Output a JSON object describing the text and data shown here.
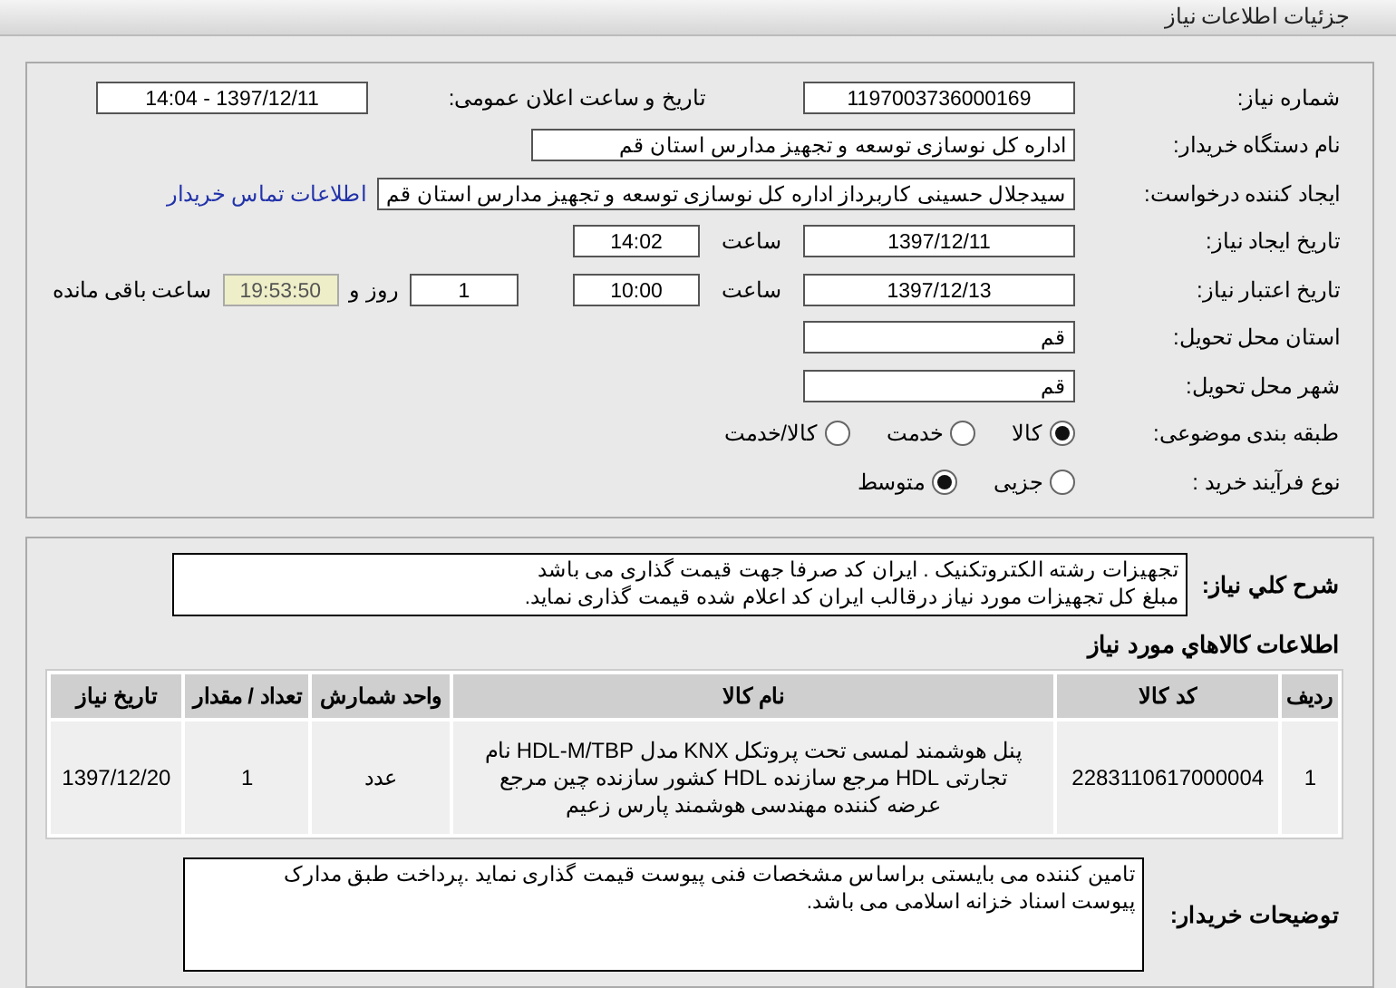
{
  "header": {
    "title": "جزئیات اطلاعات نیاز"
  },
  "form": {
    "need_number": {
      "label": "شماره نیاز:",
      "value": "1197003736000169"
    },
    "announce": {
      "label": "تاریخ و ساعت اعلان عمومی:",
      "value": "1397/12/11 - 14:04"
    },
    "buyer_org": {
      "label": "نام دستگاه خریدار:",
      "value": "اداره کل نوسازی توسعه و تجهیز مدارس استان قم"
    },
    "requester": {
      "label": "ایجاد کننده درخواست:",
      "value": "سیدجلال حسینی کاربرداز اداره کل نوسازی توسعه و تجهیز مدارس استان قم",
      "link": "اطلاعات تماس خریدار"
    },
    "created": {
      "label": "تاریخ ایجاد نیاز:",
      "date": "1397/12/11",
      "time_label": "ساعت",
      "time": "14:02"
    },
    "validity": {
      "label": "تاریخ اعتبار نیاز:",
      "date": "1397/12/13",
      "time_label": "ساعت",
      "time": "10:00",
      "days": "1",
      "days_label": "روز و",
      "remaining": "19:53:50",
      "remaining_label": "ساعت باقی مانده"
    },
    "province": {
      "label": "استان محل تحویل:",
      "value": "قم"
    },
    "city": {
      "label": "شهر محل تحویل:",
      "value": "قم"
    },
    "category": {
      "label": "طبقه بندی موضوعی:",
      "options": [
        {
          "label": "کالا",
          "selected": true
        },
        {
          "label": "خدمت",
          "selected": false
        },
        {
          "label": "کالا/خدمت",
          "selected": false
        }
      ]
    },
    "purchase_type": {
      "label": "نوع فرآیند خرید :",
      "options": [
        {
          "label": "جزیی",
          "selected": false
        },
        {
          "label": "متوسط",
          "selected": true
        }
      ]
    }
  },
  "description": {
    "label": "شرح کلي نیاز:",
    "text": "تجهیزات رشته الکتروتکنیک . ایران کد صرفا جهت قیمت گذاری می باشد\nمبلغ کل تجهیزات مورد نیاز درقالب ایران کد اعلام شده قیمت گذاری نماید."
  },
  "items_title": "اطلاعات کالاهاي مورد نياز",
  "table": {
    "columns": [
      "ردیف",
      "کد کالا",
      "نام کالا",
      "واحد شمارش",
      "تعداد / مقدار",
      "تاریخ نیاز"
    ],
    "rows": [
      {
        "cells": [
          "1",
          "2283110617000004",
          "پنل هوشمند لمسی تحت پروتکل KNX مدل HDL-M/TBP نام\nتجارتی HDL مرجع سازنده HDL کشور سازنده چین مرجع\nعرضه کننده مهندسی هوشمند پارس زعیم",
          "عدد",
          "1",
          "1397/12/20"
        ]
      }
    ]
  },
  "buyer_notes": {
    "label": "توضیحات خریدار:",
    "text": "تامین کننده می بایستی براساس مشخصات فنی پیوست قیمت گذاری نماید .پرداخت طبق مدارک\nپیوست اسناد خزانه اسلامی می باشد."
  }
}
